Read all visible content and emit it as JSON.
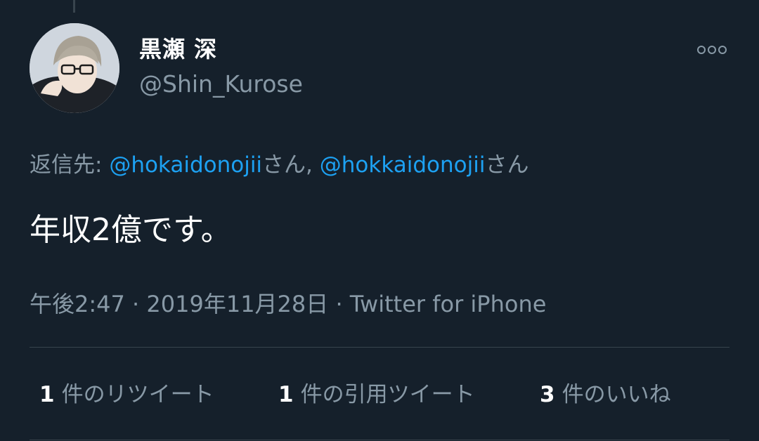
{
  "tweet": {
    "author": {
      "display_name": "黒瀬 深",
      "handle": "@Shin_Kurose",
      "avatar_icon": "anime-avatar-glasses"
    },
    "more_icon": "more-dots-icon",
    "reply_to": {
      "prefix": "返信先: ",
      "mentions": [
        {
          "handle": "@hokaidonojii",
          "suffix": "さん"
        },
        {
          "handle": "@hokkaidonojii",
          "suffix": "さん"
        }
      ],
      "separator": ", "
    },
    "text": "年収2億です。",
    "meta": {
      "time": "午後2:47",
      "date": "2019年11月28日",
      "source": "Twitter for iPhone",
      "separator": " · "
    },
    "stats": [
      {
        "count": "1",
        "label": "件のリツイート"
      },
      {
        "count": "1",
        "label": "件の引用ツイート"
      },
      {
        "count": "3",
        "label": "件のいいね"
      }
    ]
  },
  "colors": {
    "background": "#15202b",
    "primary_text": "#ffffff",
    "secondary_text": "#8899a6",
    "link": "#1da1f2",
    "divider": "#38444d"
  }
}
